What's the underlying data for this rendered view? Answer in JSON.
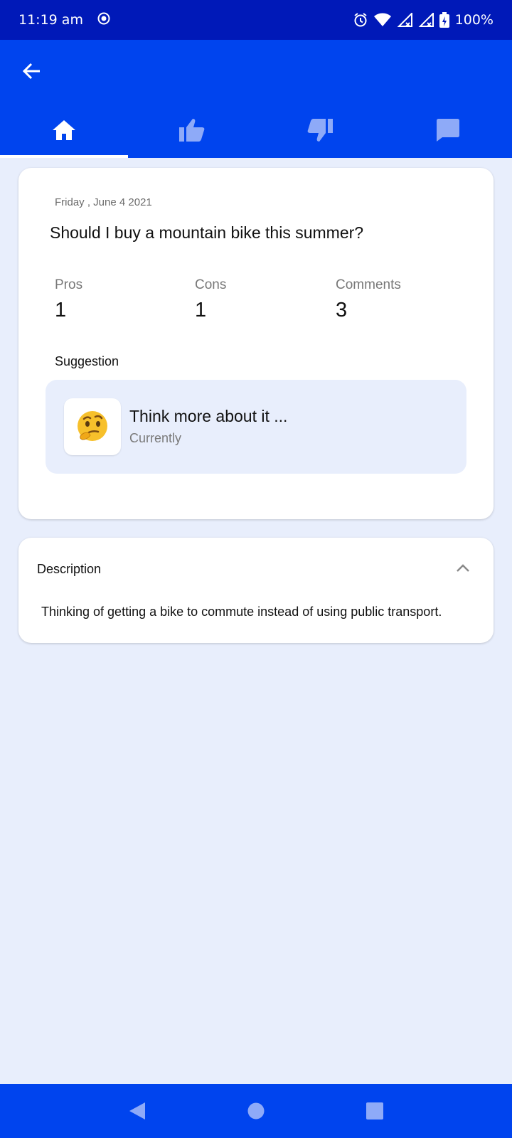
{
  "status_bar": {
    "time": "11:19 am",
    "battery": "100%",
    "icons": [
      "record-icon",
      "alarm-icon",
      "wifi-icon",
      "signal-icon",
      "signal-icon",
      "battery-charging-icon"
    ]
  },
  "app_bar": {
    "back_icon": "arrow-left-icon",
    "tabs": [
      {
        "icon": "home-icon",
        "active": true
      },
      {
        "icon": "thumb-up-icon",
        "active": false
      },
      {
        "icon": "thumb-down-icon",
        "active": false
      },
      {
        "icon": "comment-icon",
        "active": false
      }
    ]
  },
  "main": {
    "date": "Friday , June 4 2021",
    "question": "Should I buy a mountain bike this summer?",
    "stats": [
      {
        "label": "Pros",
        "value": "1"
      },
      {
        "label": "Cons",
        "value": "1"
      },
      {
        "label": "Comments",
        "value": "3"
      }
    ],
    "suggestion_label": "Suggestion",
    "suggestion": {
      "emoji": "🤔",
      "title": "Think more about it ...",
      "subtitle": "Currently"
    }
  },
  "description": {
    "title": "Description",
    "text": "Thinking of getting a bike to commute instead of using public transport."
  },
  "colors": {
    "status_bar": "#0019b8",
    "app_bar": "#0044ee",
    "background": "#e8eefc",
    "inactive_tab_icon": "#8eaaf8"
  }
}
